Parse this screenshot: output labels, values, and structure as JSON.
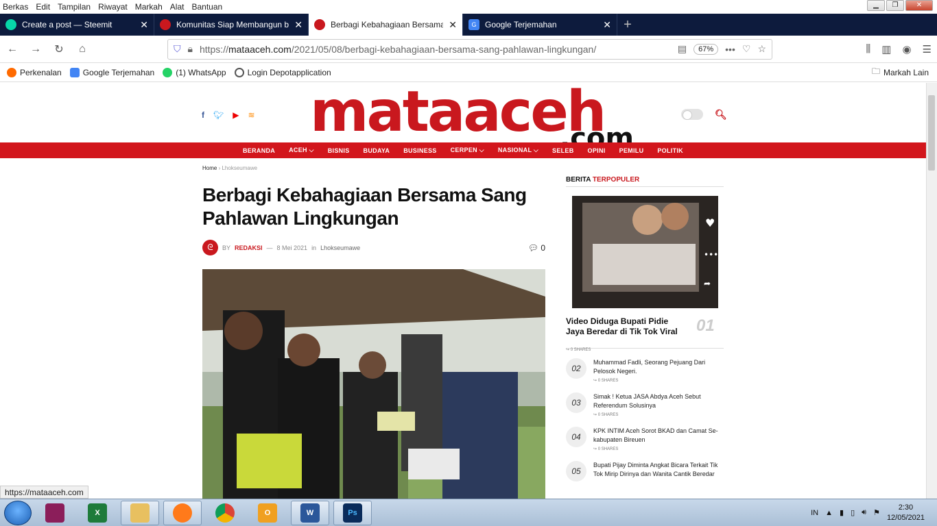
{
  "menu": [
    "Berkas",
    "Edit",
    "Tampilan",
    "Riwayat",
    "Markah",
    "Alat",
    "Bantuan"
  ],
  "tabs": [
    {
      "label": "Create a post — Steemit",
      "icon": "steemit-icon",
      "color": "#07d7a9"
    },
    {
      "label": "Komunitas Siap Membangun b",
      "icon": "flag-icon",
      "color": "#c9181e"
    },
    {
      "label": "Berbagi Kebahagiaan Bersama",
      "icon": "mataaceh-icon",
      "color": "#c9181e"
    },
    {
      "label": "Google Terjemahan",
      "icon": "translate-icon",
      "color": "#4285f4"
    }
  ],
  "address": {
    "prefix": "https://",
    "host": "mataaceh.com",
    "path": "/2021/05/08/berbagi-kebahagiaan-bersama-sang-pahlawan-lingkungan/",
    "zoom": "67%"
  },
  "bookmarks": [
    {
      "label": "Perkenalan",
      "color": "#ff6a00"
    },
    {
      "label": "Google Terjemahan",
      "color": "#4285f4"
    },
    {
      "label": "(1) WhatsApp",
      "color": "#25d366"
    },
    {
      "label": "Login Depotapplication",
      "color": "#555"
    }
  ],
  "bookmarks_other": "Markah Lain",
  "site": {
    "logo_main": "mataaceh",
    "logo_suffix": ".com",
    "nav": [
      "BERANDA",
      "ACEH ⌵",
      "BISNIS",
      "BUDAYA",
      "BUSINESS",
      "CERPEN ⌵",
      "NASIONAL ⌵",
      "SELEB",
      "OPINI",
      "PEMILU",
      "POLITIK"
    ]
  },
  "article": {
    "breadcrumb_home": "Home",
    "breadcrumb_sep": "›",
    "breadcrumb_cat": "Lhokseumawe",
    "title": "Berbagi Kebahagiaan Bersama Sang Pahlawan Lingkungan",
    "by": "BY",
    "author": "REDAKSI",
    "date": "8 Mei 2021",
    "in": "in",
    "category": "Lhokseumawe",
    "comments": "0"
  },
  "sidebar": {
    "head_a": "BERITA",
    "head_b": "TERPOPULER",
    "top": {
      "title": "Video Diduga Bupati Pidie Jaya Beredar di Tik Tok Viral",
      "num": "01",
      "shares": "0 SHARES"
    },
    "items": [
      {
        "num": "02",
        "title": "Muhammad Fadli, Seorang Pejuang Dari Pelosok Negeri.",
        "shares": "0 SHARES"
      },
      {
        "num": "03",
        "title": "Simak ! Ketua JASA Abdya Aceh Sebut Referendum Solusinya",
        "shares": "0 SHARES"
      },
      {
        "num": "04",
        "title": "KPK INTIM Aceh Sorot BKAD dan Camat Se-kabupaten Bireuen",
        "shares": "0 SHARES"
      },
      {
        "num": "05",
        "title": "Bupati Pijay Diminta Angkat Bicara Terkait Tik Tok Mirip Dirinya dan Wanita Cantik Beredar",
        "shares": ""
      }
    ]
  },
  "status_url": "https://mataaceh.com",
  "tray": {
    "lang": "IN",
    "time": "2:30",
    "date": "12/05/2021"
  }
}
